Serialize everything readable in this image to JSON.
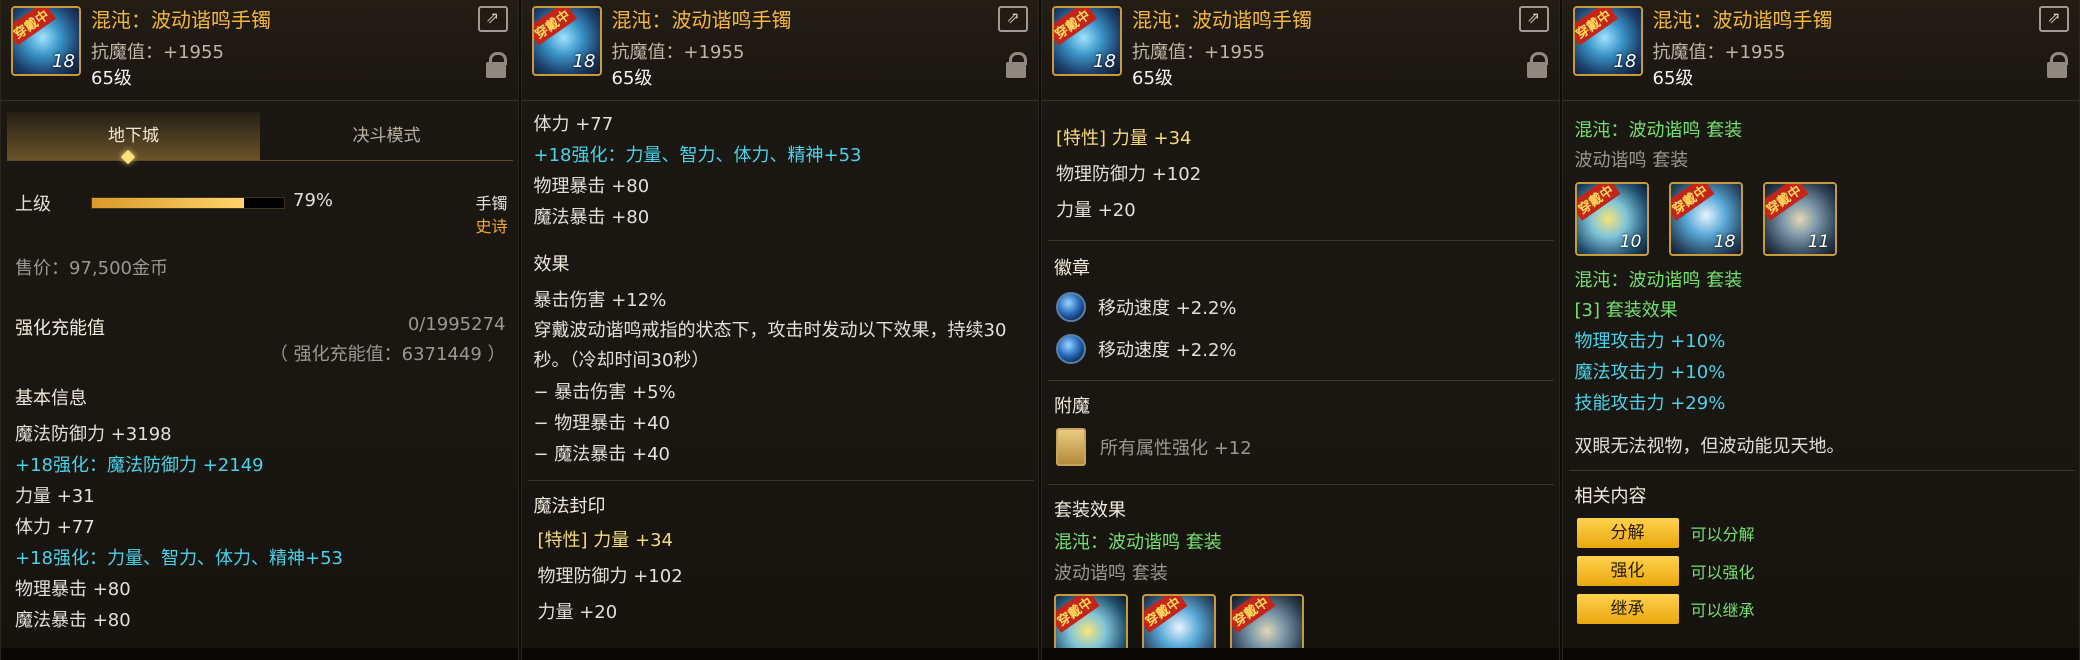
{
  "item": {
    "name": "混沌：波动谐鸣手镯",
    "stat": "抗魔值：+1955",
    "level": "65级",
    "icon_tag": "穿戴中",
    "icon_num": "18",
    "icon_partial": "6"
  },
  "panel1": {
    "tabs": [
      "地下城",
      "决斗模式"
    ],
    "grade_label": "上级",
    "grade_percent": "79%",
    "grade_progress": 0.79,
    "slot": "手镯",
    "rarity": "史诗",
    "price": "售价：97,500金币",
    "charge_label": "强化充能值",
    "charge_value": "0/1995274",
    "charge_sub": "（ 强化充能值：6371449 ）",
    "basic_label": "基本信息",
    "lines": [
      "魔法防御力 +3198",
      "+18强化：魔法防御力 +2149",
      "力量 +31",
      "体力 +77",
      "+18强化：力量、智力、体力、精神+53",
      "物理暴击 +80",
      "魔法暴击 +80"
    ]
  },
  "panel2": {
    "top_lines": [
      "体力 +77",
      "+18强化：力量、智力、体力、精神+53",
      "物理暴击 +80",
      "魔法暴击 +80"
    ],
    "effect_label": "效果",
    "effect_lines": [
      "暴击伤害 +12%",
      "穿戴波动谐鸣戒指的状态下，攻击时发动以下效果，持续30",
      "秒。（冷却时间30秒）",
      "− 暴击伤害 +5%",
      "− 物理暴击 +40",
      "− 魔法暴击 +40"
    ],
    "seal_label": "魔法封印",
    "seal_lines": [
      "[特性] 力量 +34",
      "物理防御力 +102",
      "力量 +20"
    ]
  },
  "panel3": {
    "seal_lines": [
      "[特性] 力量 +34",
      "物理防御力 +102",
      "力量 +20"
    ],
    "emblem_label": "徽章",
    "emblems": [
      "移动速度 +2.2%",
      "移动速度 +2.2%"
    ],
    "enchant_label": "附魔",
    "enchant": "所有属性强化 +12",
    "set_effect_label": "套装效果",
    "set_name": "混沌：波动谐鸣 套装",
    "set_sub": "波动谐鸣 套装"
  },
  "panel4": {
    "set_name": "混沌：波动谐鸣 套装",
    "set_sub": "波动谐鸣 套装",
    "set_icons": [
      {
        "tag": "穿戴中",
        "num": "10",
        "partial": "6"
      },
      {
        "tag": "穿戴中",
        "num": "18",
        "partial": "6"
      },
      {
        "tag": "穿戴中",
        "num": "11",
        "partial": "6"
      }
    ],
    "set_name2": "混沌：波动谐鸣 套装",
    "set_count": "[3] 套装效果",
    "bonuses": [
      "物理攻击力 +10%",
      "魔法攻击力 +10%",
      "技能攻击力 +29%"
    ],
    "flavor": "双眼无法视物，但波动能见天地。",
    "related_label": "相关内容",
    "related": [
      {
        "button": "分解",
        "desc": "可以分解"
      },
      {
        "button": "强化",
        "desc": "可以强化"
      },
      {
        "button": "继承",
        "desc": "可以继承"
      }
    ]
  },
  "colors": {
    "gold": "#f3b63f",
    "cyan": "#49d3ea",
    "green": "#74e06e",
    "button": "#f5c22c"
  }
}
